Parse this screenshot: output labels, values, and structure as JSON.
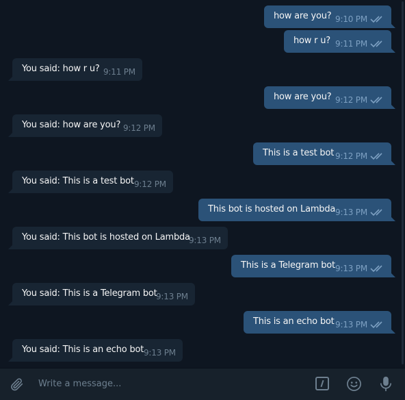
{
  "messages": [
    {
      "dir": "out",
      "text": "how are you?",
      "time": "9:10 PM",
      "read": true
    },
    {
      "dir": "out",
      "text": "how r u?",
      "time": "9:11 PM",
      "read": true
    },
    {
      "dir": "in",
      "text": "You said: how r u?",
      "time": "9:11 PM"
    },
    {
      "dir": "out",
      "text": "how are you?",
      "time": "9:12 PM",
      "read": true
    },
    {
      "dir": "in",
      "text": "You said: how are you?",
      "time": "9:12 PM"
    },
    {
      "dir": "out",
      "text": "This is a test bot",
      "time": "9:12 PM",
      "read": true
    },
    {
      "dir": "in",
      "text": "You said: This is a test bot",
      "time": "9:12 PM"
    },
    {
      "dir": "out",
      "text": "This bot is hosted on Lambda",
      "time": "9:13 PM",
      "read": true
    },
    {
      "dir": "in",
      "text": "You said: This bot is hosted on Lambda",
      "time": "9:13 PM"
    },
    {
      "dir": "out",
      "text": "This is a Telegram bot",
      "time": "9:13 PM",
      "read": true
    },
    {
      "dir": "in",
      "text": "You said: This is a Telegram bot",
      "time": "9:13 PM"
    },
    {
      "dir": "out",
      "text": "This is an echo bot",
      "time": "9:13 PM",
      "read": true
    },
    {
      "dir": "in",
      "text": "You said: This is an echo bot",
      "time": "9:13 PM"
    }
  ],
  "composer": {
    "placeholder": "Write a message...",
    "attach_icon": "paperclip-icon",
    "commands_icon": "bot-commands-icon",
    "emoji_icon": "emoji-icon",
    "mic_icon": "microphone-icon"
  },
  "colors": {
    "background": "#0e1621",
    "outgoing_bubble": "#2b5278",
    "incoming_bubble": "#182533",
    "composer": "#17212b",
    "read_check": "#7da0c2"
  }
}
